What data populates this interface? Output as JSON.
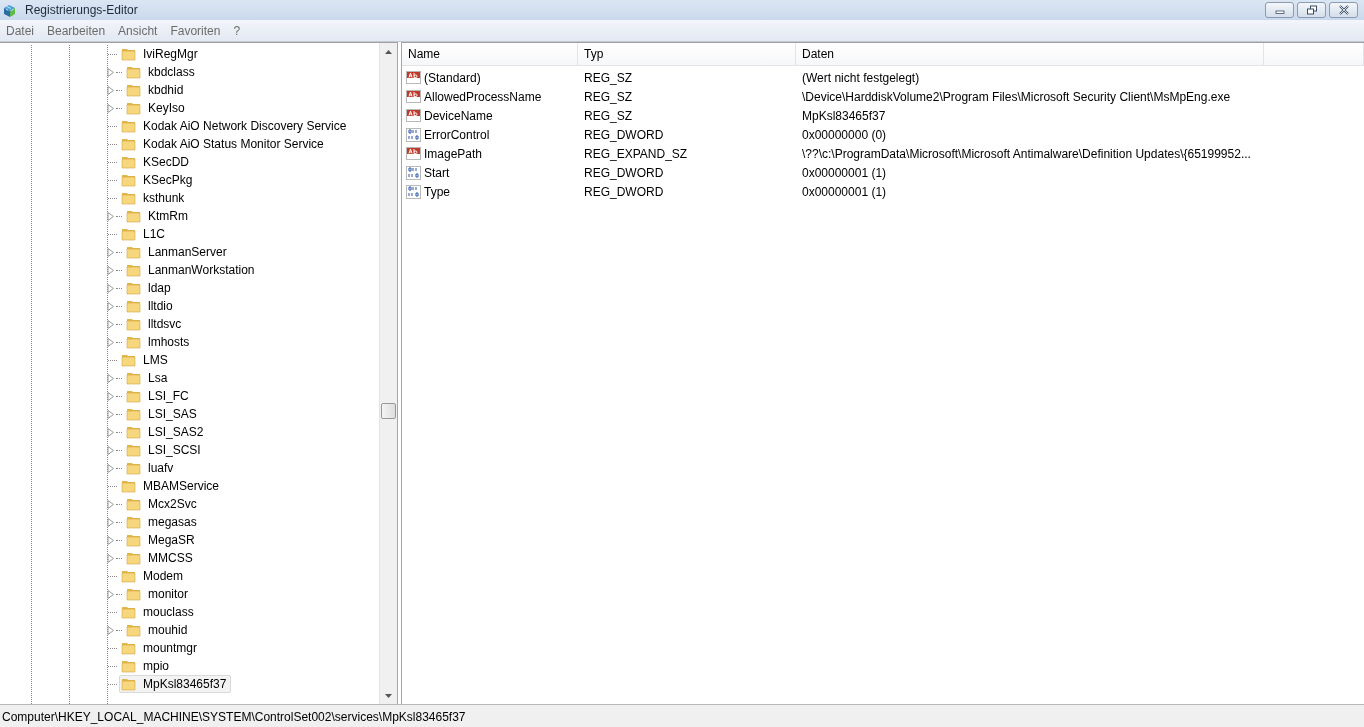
{
  "window": {
    "title": "Registrierungs-Editor"
  },
  "menu": [
    "Datei",
    "Bearbeiten",
    "Ansicht",
    "Favoriten",
    "?"
  ],
  "tree": {
    "items": [
      {
        "label": "IviRegMgr",
        "expandable": false,
        "selected": false
      },
      {
        "label": "kbdclass",
        "expandable": true,
        "selected": false
      },
      {
        "label": "kbdhid",
        "expandable": true,
        "selected": false
      },
      {
        "label": "KeyIso",
        "expandable": true,
        "selected": false
      },
      {
        "label": "Kodak AiO Network Discovery Service",
        "expandable": false,
        "selected": false
      },
      {
        "label": "Kodak AiO Status Monitor Service",
        "expandable": false,
        "selected": false
      },
      {
        "label": "KSecDD",
        "expandable": false,
        "selected": false
      },
      {
        "label": "KSecPkg",
        "expandable": false,
        "selected": false
      },
      {
        "label": "ksthunk",
        "expandable": false,
        "selected": false
      },
      {
        "label": "KtmRm",
        "expandable": true,
        "selected": false
      },
      {
        "label": "L1C",
        "expandable": false,
        "selected": false
      },
      {
        "label": "LanmanServer",
        "expandable": true,
        "selected": false
      },
      {
        "label": "LanmanWorkstation",
        "expandable": true,
        "selected": false
      },
      {
        "label": "ldap",
        "expandable": true,
        "selected": false
      },
      {
        "label": "lltdio",
        "expandable": true,
        "selected": false
      },
      {
        "label": "lltdsvc",
        "expandable": true,
        "selected": false
      },
      {
        "label": "lmhosts",
        "expandable": true,
        "selected": false
      },
      {
        "label": "LMS",
        "expandable": false,
        "selected": false
      },
      {
        "label": "Lsa",
        "expandable": true,
        "selected": false
      },
      {
        "label": "LSI_FC",
        "expandable": true,
        "selected": false
      },
      {
        "label": "LSI_SAS",
        "expandable": true,
        "selected": false
      },
      {
        "label": "LSI_SAS2",
        "expandable": true,
        "selected": false
      },
      {
        "label": "LSI_SCSI",
        "expandable": true,
        "selected": false
      },
      {
        "label": "luafv",
        "expandable": true,
        "selected": false
      },
      {
        "label": "MBAMService",
        "expandable": false,
        "selected": false
      },
      {
        "label": "Mcx2Svc",
        "expandable": true,
        "selected": false
      },
      {
        "label": "megasas",
        "expandable": true,
        "selected": false
      },
      {
        "label": "MegaSR",
        "expandable": true,
        "selected": false
      },
      {
        "label": "MMCSS",
        "expandable": true,
        "selected": false
      },
      {
        "label": "Modem",
        "expandable": false,
        "selected": false
      },
      {
        "label": "monitor",
        "expandable": true,
        "selected": false
      },
      {
        "label": "mouclass",
        "expandable": false,
        "selected": false
      },
      {
        "label": "mouhid",
        "expandable": true,
        "selected": false
      },
      {
        "label": "mountmgr",
        "expandable": false,
        "selected": false
      },
      {
        "label": "mpio",
        "expandable": false,
        "selected": false
      },
      {
        "label": "MpKsl83465f37",
        "expandable": false,
        "selected": true
      }
    ]
  },
  "values": {
    "columns": [
      "Name",
      "Typ",
      "Daten"
    ],
    "rows": [
      {
        "kind": "string",
        "name": "(Standard)",
        "type": "REG_SZ",
        "data": "(Wert nicht festgelegt)"
      },
      {
        "kind": "string",
        "name": "AllowedProcessName",
        "type": "REG_SZ",
        "data": "\\Device\\HarddiskVolume2\\Program Files\\Microsoft Security Client\\MsMpEng.exe"
      },
      {
        "kind": "string",
        "name": "DeviceName",
        "type": "REG_SZ",
        "data": "MpKsl83465f37"
      },
      {
        "kind": "binary",
        "name": "ErrorControl",
        "type": "REG_DWORD",
        "data": "0x00000000 (0)"
      },
      {
        "kind": "string",
        "name": "ImagePath",
        "type": "REG_EXPAND_SZ",
        "data": "\\??\\c:\\ProgramData\\Microsoft\\Microsoft Antimalware\\Definition Updates\\{65199952..."
      },
      {
        "kind": "binary",
        "name": "Start",
        "type": "REG_DWORD",
        "data": "0x00000001 (1)"
      },
      {
        "kind": "binary",
        "name": "Type",
        "type": "REG_DWORD",
        "data": "0x00000001 (1)"
      }
    ]
  },
  "status_bar": "Computer\\HKEY_LOCAL_MACHINE\\SYSTEM\\ControlSet002\\services\\MpKsl83465f37"
}
